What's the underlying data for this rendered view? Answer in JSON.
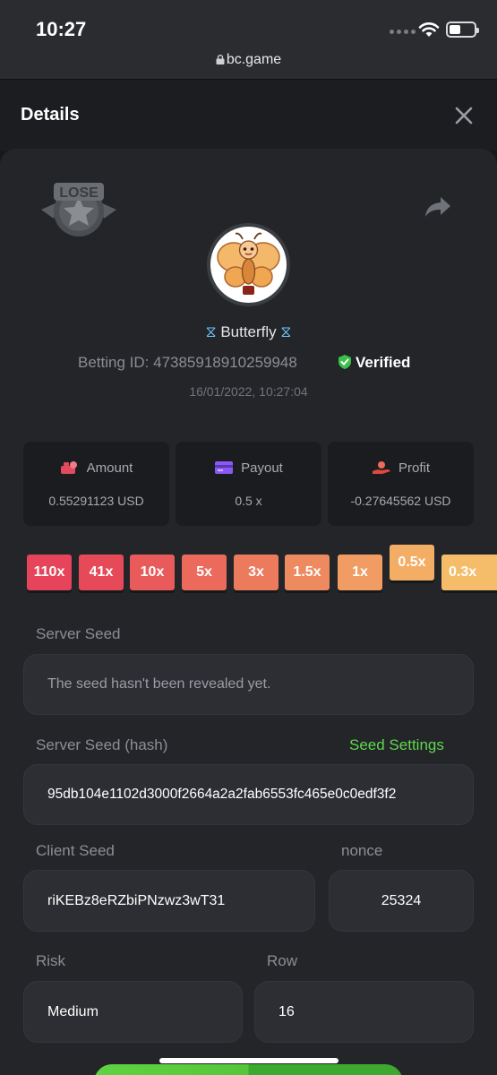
{
  "status_bar": {
    "time": "10:27",
    "url": "bc.game"
  },
  "modal": {
    "title": "Details"
  },
  "result_badge": "LOSE",
  "game": {
    "name": "Butterfly",
    "betting_id_label": "Betting ID:",
    "betting_id": "47385918910259948",
    "verified_label": "Verified",
    "datetime": "16/01/2022, 10:27:04"
  },
  "stats": {
    "amount": {
      "label": "Amount",
      "value": "0.55291123 USD"
    },
    "payout": {
      "label": "Payout",
      "value": "0.5 x"
    },
    "profit": {
      "label": "Profit",
      "value": "-0.27645562 USD"
    }
  },
  "multipliers": [
    {
      "label": "110x",
      "color": "#e6445a"
    },
    {
      "label": "41x",
      "color": "#e64a58"
    },
    {
      "label": "10x",
      "color": "#e95a5b"
    },
    {
      "label": "5x",
      "color": "#eb6a5c"
    },
    {
      "label": "3x",
      "color": "#ec7b5e"
    },
    {
      "label": "1.5x",
      "color": "#ee8a60"
    },
    {
      "label": "1x",
      "color": "#f09c62"
    },
    {
      "label": "0.5x",
      "color": "#f3ad65",
      "active": true
    },
    {
      "label": "0.3x",
      "color": "#f5bd69"
    }
  ],
  "server_seed": {
    "label": "Server Seed",
    "value": "The seed hasn't been revealed yet."
  },
  "server_seed_hash": {
    "label": "Server Seed (hash)",
    "value": "95db104e1102d3000f2664a2a2fab6553fc465e0c0edf3f2",
    "link": "Seed Settings"
  },
  "client_seed": {
    "label": "Client Seed",
    "value": "riKEBz8eRZbiPNzwz3wT31"
  },
  "nonce": {
    "label": "nonce",
    "value": "25324"
  },
  "risk": {
    "label": "Risk",
    "value": "Medium"
  },
  "row": {
    "label": "Row",
    "value": "16"
  },
  "colors": {
    "accent_green": "#5ed84d",
    "panel": "#232529",
    "field": "#2c2e33"
  }
}
